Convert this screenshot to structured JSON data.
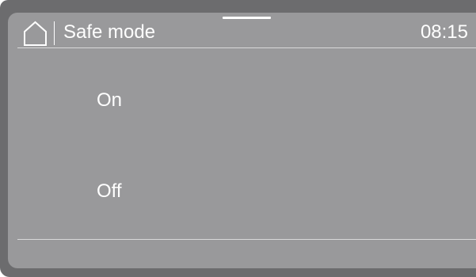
{
  "header": {
    "title": "Safe mode",
    "time": "08:15",
    "home_icon": "home-icon"
  },
  "options": [
    {
      "label": "On"
    },
    {
      "label": "Off"
    }
  ],
  "colors": {
    "frame": "#6c6c6e",
    "screen": "#99999b",
    "text": "#ffffff",
    "divider": "#d9d9da"
  }
}
